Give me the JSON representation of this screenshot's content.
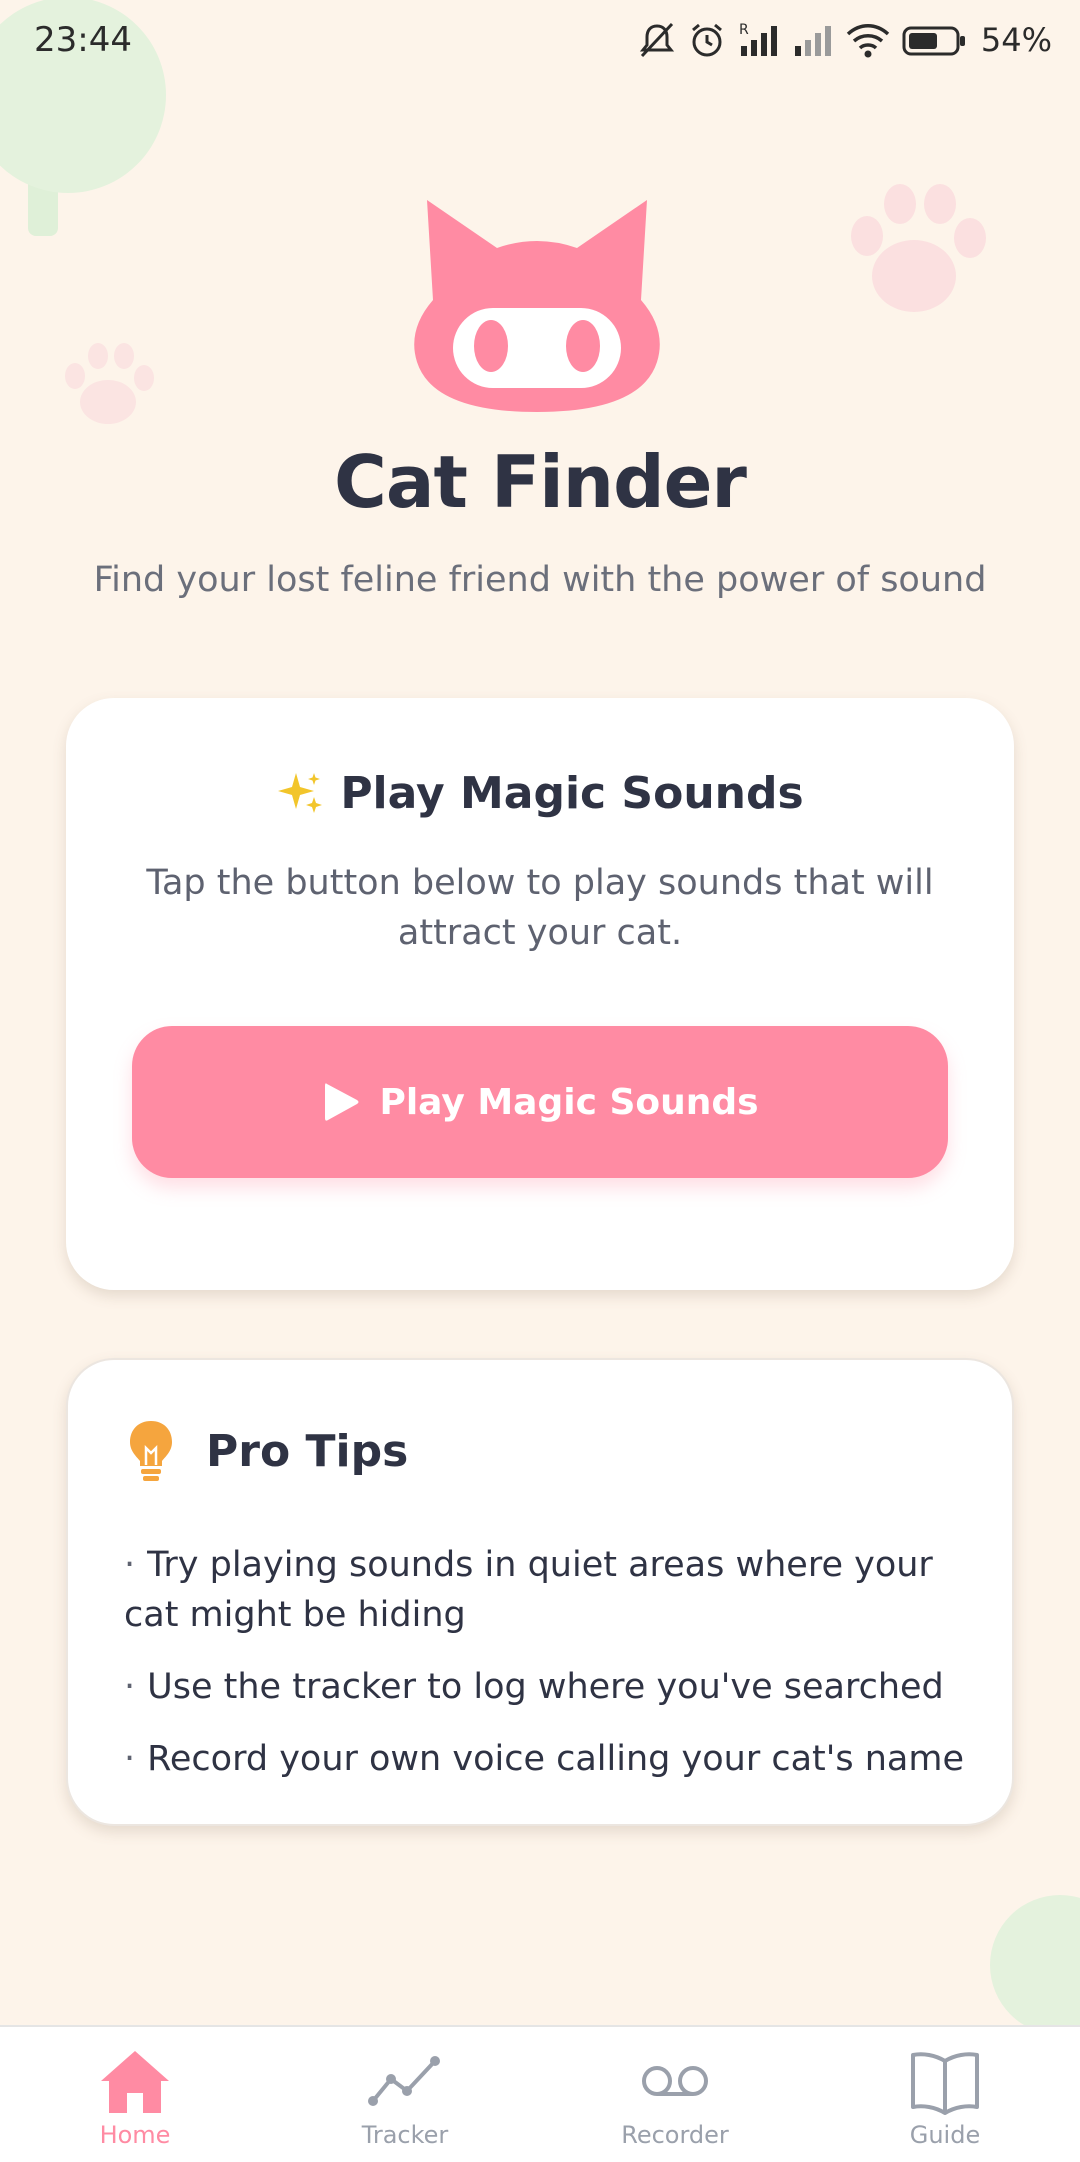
{
  "status_bar": {
    "time": "23:44",
    "battery": "54%",
    "icons": [
      "mute-icon",
      "alarm-icon",
      "signal-r-icon",
      "signal-icon",
      "wifi-icon",
      "battery-icon"
    ]
  },
  "app": {
    "logo_icon": "cat-face-logo-icon",
    "title": "Cat Finder",
    "subtitle": "Find your lost feline friend with the power of sound"
  },
  "magic_card": {
    "icon": "sparkles-icon",
    "heading": "Play Magic Sounds",
    "description": "Tap the button below to play sounds that will attract your cat.",
    "button": {
      "icon": "play-icon",
      "label": "Play Magic Sounds"
    }
  },
  "tips_card": {
    "icon": "lightbulb-icon",
    "heading": "Pro Tips",
    "tips": [
      "Try playing sounds in quiet areas where your cat might be hiding",
      "Use the tracker to log where you've searched",
      "Record your own voice calling your cat's name"
    ]
  },
  "bottom_nav": {
    "items": [
      {
        "label": "Home",
        "icon": "home-icon",
        "active": true
      },
      {
        "label": "Tracker",
        "icon": "chart-line-icon",
        "active": false
      },
      {
        "label": "Recorder",
        "icon": "voicemail-icon",
        "active": false
      },
      {
        "label": "Guide",
        "icon": "book-icon",
        "active": false
      }
    ]
  },
  "colors": {
    "background": "#fdf4ea",
    "accent_pink": "#ff8ba3",
    "text_dark": "#2f3344",
    "text_muted": "#6b6f7b",
    "nav_inactive": "#9aa0ab",
    "sparkle_yellow": "#f2c52b",
    "bulb_orange": "#f5a53e"
  }
}
